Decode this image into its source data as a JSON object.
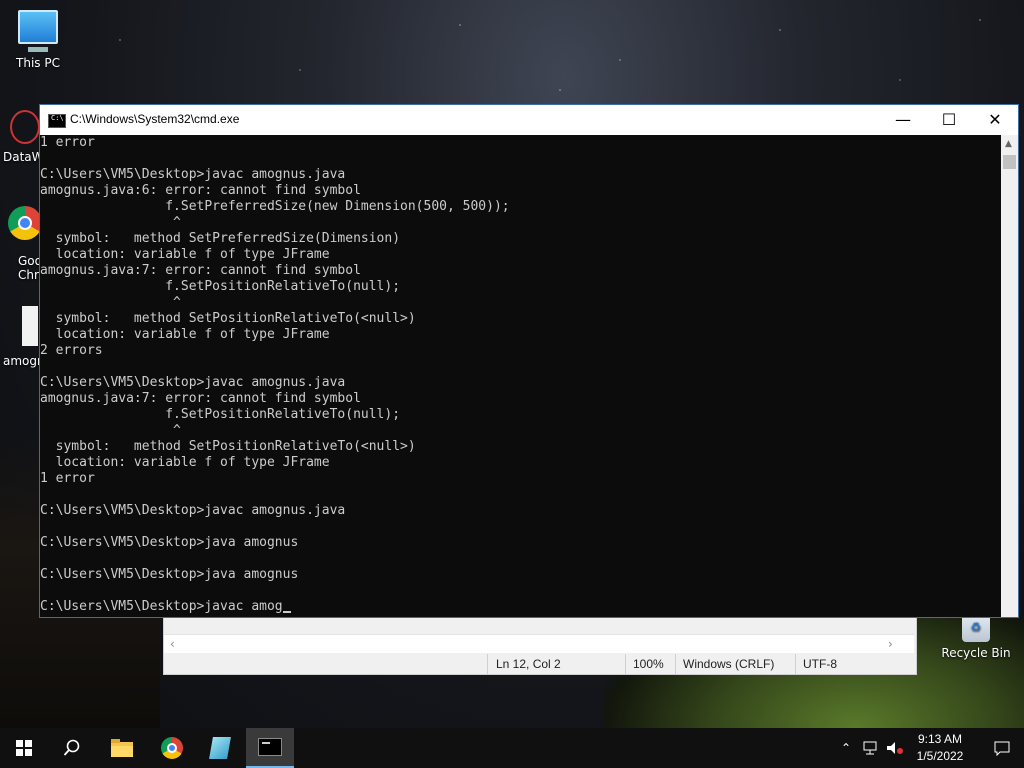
{
  "desktop": {
    "icons": {
      "this_pc": "This PC",
      "recycle_bin": "Recycle Bin",
      "partial_datawrapper": "DataW",
      "partial_chrome_1": "Goo",
      "partial_chrome_2": "Chro",
      "partial_amognus": "amogn"
    }
  },
  "cmd": {
    "title": "C:\\Windows\\System32\\cmd.exe",
    "lines": [
      "1 error",
      "",
      "C:\\Users\\VM5\\Desktop>javac amognus.java",
      "amognus.java:6: error: cannot find symbol",
      "                f.SetPreferredSize(new Dimension(500, 500));",
      "                 ^",
      "  symbol:   method SetPreferredSize(Dimension)",
      "  location: variable f of type JFrame",
      "amognus.java:7: error: cannot find symbol",
      "                f.SetPositionRelativeTo(null);",
      "                 ^",
      "  symbol:   method SetPositionRelativeTo(<null>)",
      "  location: variable f of type JFrame",
      "2 errors",
      "",
      "C:\\Users\\VM5\\Desktop>javac amognus.java",
      "amognus.java:7: error: cannot find symbol",
      "                f.SetPositionRelativeTo(null);",
      "                 ^",
      "  symbol:   method SetPositionRelativeTo(<null>)",
      "  location: variable f of type JFrame",
      "1 error",
      "",
      "C:\\Users\\VM5\\Desktop>javac amognus.java",
      "",
      "C:\\Users\\VM5\\Desktop>java amognus",
      "",
      "C:\\Users\\VM5\\Desktop>java amognus",
      ""
    ],
    "prompt_line": "C:\\Users\\VM5\\Desktop>javac amog"
  },
  "notepad": {
    "status": {
      "position": "Ln 12, Col 2",
      "zoom": "100%",
      "line_ending": "Windows (CRLF)",
      "encoding": "UTF-8"
    }
  },
  "taskbar": {
    "time": "9:13 AM",
    "date": "1/5/2022"
  }
}
